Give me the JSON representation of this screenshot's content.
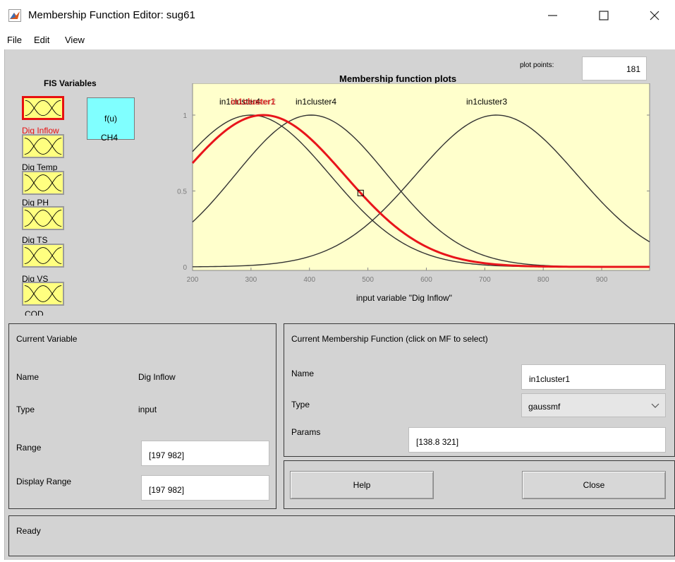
{
  "window": {
    "title": "Membership Function Editor: sug61",
    "minimize_glyph": "—",
    "maximize_glyph": "☐",
    "close_glyph": "✕",
    "app_icon": "matlab-icon"
  },
  "menu": [
    "File",
    "Edit",
    "View"
  ],
  "fis_variables": {
    "title": "FIS Variables",
    "inputs": [
      {
        "name": "Dig Inflow",
        "selected": true
      },
      {
        "name": "Dig Temp",
        "selected": false
      },
      {
        "name": "Dig PH",
        "selected": false
      },
      {
        "name": "Dig TS",
        "selected": false
      },
      {
        "name": "Dig VS",
        "selected": false
      },
      {
        "name": "COD",
        "selected": false
      }
    ],
    "output": {
      "symbol": "f(u)",
      "name": "CH4"
    }
  },
  "plot": {
    "title": "Membership function plots",
    "plot_points_label": "plot points:",
    "plot_points_value": "181",
    "mf_labels": [
      "in1cluster1",
      "in1cluster2",
      "in1cluster4",
      "in1cluster3"
    ],
    "mf_label_overlap_text": "in1cluster4",
    "mf_label_right_text": "in1cluster3"
  },
  "chart_data": {
    "type": "line",
    "xlabel": "input variable \"Dig Inflow\"",
    "ylabel": "",
    "xlim": [
      200,
      982
    ],
    "ylim": [
      0,
      1
    ],
    "xticks": [
      200,
      300,
      400,
      500,
      600,
      700,
      800,
      900
    ],
    "yticks": [
      0,
      0.5,
      1
    ],
    "ytick_labels": [
      "0",
      "0.5",
      "1"
    ],
    "series": [
      {
        "name": "in1cluster1",
        "type": "gaussmf",
        "sigma": 138.8,
        "center": 321,
        "selected": true,
        "color": "#e8141b"
      },
      {
        "name": "in1cluster2",
        "type": "gaussmf",
        "sigma": 135,
        "center": 300,
        "selected": false,
        "color": "#333333"
      },
      {
        "name": "in1cluster4",
        "type": "gaussmf",
        "sigma": 130,
        "center": 403,
        "selected": false,
        "color": "#333333"
      },
      {
        "name": "in1cluster3",
        "type": "gaussmf",
        "sigma": 138,
        "center": 720,
        "selected": false,
        "color": "#333333"
      }
    ],
    "background": "#ffffcc"
  },
  "current_variable": {
    "title": "Current Variable",
    "name_label": "Name",
    "name_value": "Dig Inflow",
    "type_label": "Type",
    "type_value": "input",
    "range_label": "Range",
    "range_value": "[197 982]",
    "display_range_label": "Display Range",
    "display_range_value": "[197 982]"
  },
  "current_mf": {
    "title": "Current Membership Function (click on MF to select)",
    "name_label": "Name",
    "name_value": "in1cluster1",
    "type_label": "Type",
    "type_value": "gaussmf",
    "params_label": "Params",
    "params_value": "[138.8 321]"
  },
  "buttons": {
    "help": "Help",
    "close": "Close"
  },
  "status": {
    "text": "Ready"
  },
  "colors": {
    "selected": "#e81010",
    "input_box": "#ffff80",
    "output_box": "#80ffff",
    "panel_bg": "#d3d3d3"
  }
}
